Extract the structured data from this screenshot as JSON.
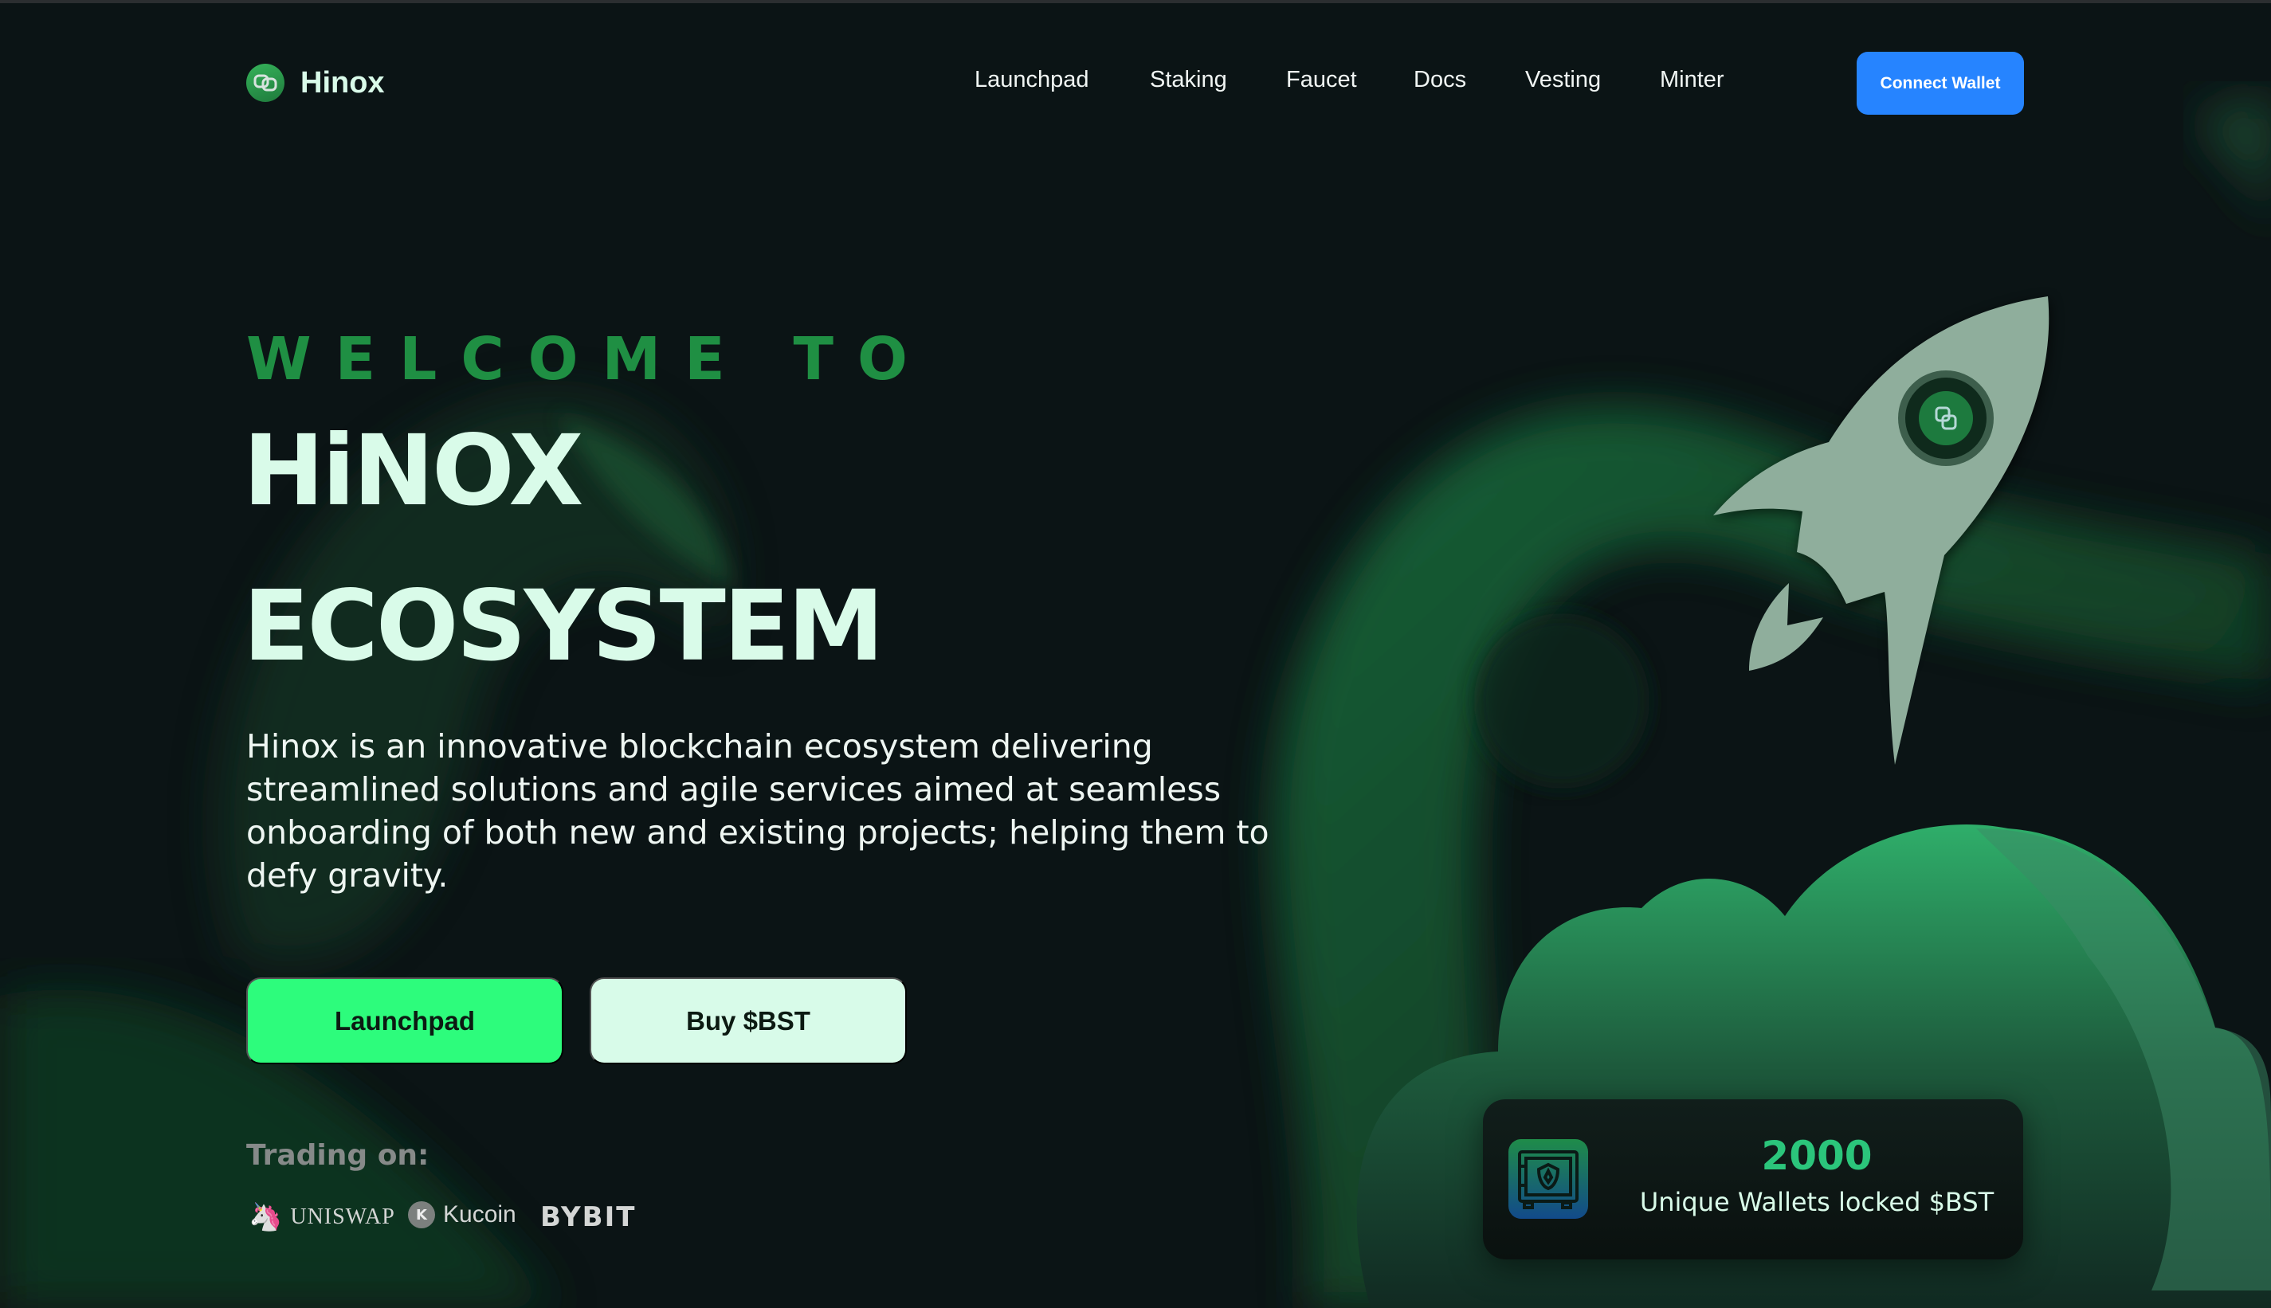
{
  "brand": {
    "name": "Hinox",
    "logo_icon": "linked-chain-icon"
  },
  "nav": {
    "items": [
      {
        "label": "Launchpad"
      },
      {
        "label": "Staking"
      },
      {
        "label": "Faucet"
      },
      {
        "label": "Docs"
      },
      {
        "label": "Vesting"
      },
      {
        "label": "Minter"
      }
    ],
    "connect_label": "Connect Wallet"
  },
  "hero": {
    "welcome": "WELCOME TO",
    "title_line1": "HiNOX",
    "title_line2": "ECOSYSTEM",
    "description": "Hinox is an innovative blockchain ecosystem delivering streamlined solutions and agile services aimed at seamless onboarding of both new and existing projects; helping them to defy gravity.",
    "launchpad_label": "Launchpad",
    "buy_label": "Buy $BST"
  },
  "trading": {
    "label": "Trading on:",
    "exchanges": [
      {
        "name": "UNISWAP"
      },
      {
        "name": "Kucoin"
      },
      {
        "name": "BYBIT"
      }
    ]
  },
  "stat": {
    "value": "2000",
    "label": "Unique Wallets locked $BST",
    "icon": "safe-icon"
  },
  "colors": {
    "accent_green": "#2dfc7c",
    "welcome_green": "#1f8f43",
    "connect_blue": "#2684ff",
    "title_mint": "#d9fbe9",
    "background": "#0a1114"
  }
}
